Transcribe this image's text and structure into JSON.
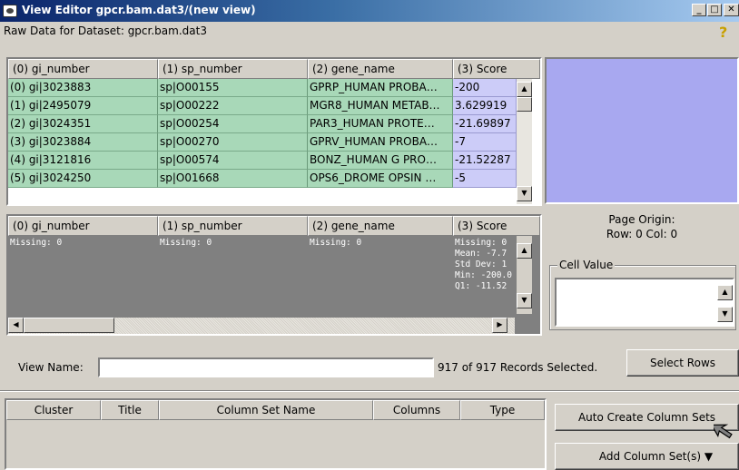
{
  "window": {
    "title": "View Editor gpcr.bam.dat3/(new view)",
    "minimize": "_",
    "maximize": "□",
    "close": "✕"
  },
  "raw_data_label": "Raw Data for Dataset: gpcr.bam.dat3",
  "top_table": {
    "headers": [
      "(0) gi_number",
      "(1) sp_number",
      "(2) gene_name",
      "(3) Score"
    ],
    "rows": [
      [
        "(0) gi|3023883",
        "sp|O00155",
        "GPRP_HUMAN PROBA…",
        "-200"
      ],
      [
        "(1) gi|2495079",
        "sp|O00222",
        "MGR8_HUMAN METAB…",
        "3.629919"
      ],
      [
        "(2) gi|3024351",
        "sp|O00254",
        "PAR3_HUMAN PROTE…",
        "-21.69897"
      ],
      [
        "(3) gi|3023884",
        "sp|O00270",
        "GPRV_HUMAN PROBA…",
        "-7"
      ],
      [
        "(4) gi|3121816",
        "sp|O00574",
        "BONZ_HUMAN G PRO…",
        "-21.52287"
      ],
      [
        "(5) gi|3024250",
        "sp|O01668",
        "OPS6_DROME OPSIN …",
        "-5"
      ]
    ]
  },
  "bottom_table": {
    "headers": [
      "(0) gi_number",
      "(1) sp_number",
      "(2) gene_name",
      "(3) Score"
    ],
    "missing": [
      "Missing: 0",
      "Missing: 0",
      "Missing: 0"
    ],
    "score_stats": "Missing: 0\nMean: -7.7\nStd Dev: 1\nMin: -200.0\nQ1: -11.52"
  },
  "page_origin": {
    "title": "Page Origin:",
    "row_col": "Row: 0    Col: 0"
  },
  "cell_value": {
    "label": "Cell Value",
    "value": ""
  },
  "view_name": {
    "label": "View Name:",
    "value": "",
    "records": "917 of 917 Records Selected.",
    "select_rows_label": "Select Rows"
  },
  "cluster_table": {
    "headers": [
      "Cluster",
      "Title",
      "Column Set Name",
      "Columns",
      "Type"
    ]
  },
  "buttons": {
    "auto_create": "Auto Create Column Sets",
    "add_column_set": "Add Column Set(s) ▼"
  },
  "icons": {
    "scroll_up": "▲",
    "scroll_down": "▼",
    "scroll_left": "◀",
    "scroll_right": "▶",
    "help": "?"
  }
}
